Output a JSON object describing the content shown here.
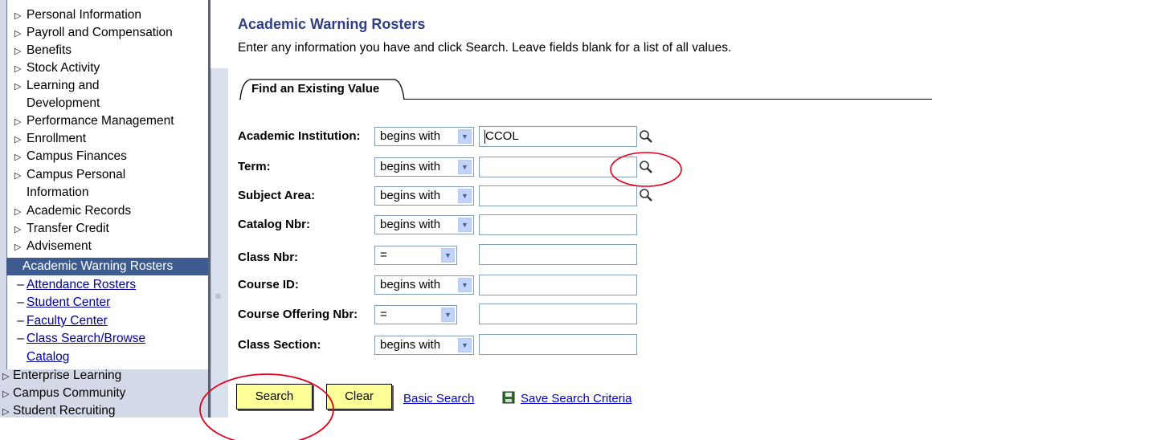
{
  "nav": {
    "items": [
      {
        "label": "Personal Information"
      },
      {
        "label": "Payroll and Compensation"
      },
      {
        "label": "Benefits"
      },
      {
        "label": "Stock Activity"
      },
      {
        "label": "Learning and",
        "cont": "Development"
      },
      {
        "label": "Performance Management"
      },
      {
        "label": "Enrollment"
      },
      {
        "label": "Campus Finances"
      },
      {
        "label": "Campus Personal",
        "cont": "Information"
      },
      {
        "label": "Academic Records"
      },
      {
        "label": "Transfer Credit"
      },
      {
        "label": "Advisement"
      }
    ],
    "selected": "Academic Warning Rosters",
    "links": [
      {
        "label": "Attendance Rosters"
      },
      {
        "label": "Student Center"
      },
      {
        "label": "Faculty Center"
      },
      {
        "label": "Class Search/Browse",
        "cont": "Catalog"
      }
    ],
    "top_items": [
      {
        "label": "Enterprise Learning"
      },
      {
        "label": "Campus Community"
      },
      {
        "label": "Student Recruiting"
      }
    ]
  },
  "page": {
    "title": "Academic Warning Rosters",
    "instructions": "Enter any information you have and click Search. Leave fields blank for a list of all values.",
    "tab_label": "Find an Existing Value"
  },
  "form": {
    "fields": [
      {
        "label": "Academic Institution:",
        "operator": "begins with",
        "value": "CCOL",
        "lookup": true
      },
      {
        "label": "Term:",
        "operator": "begins with",
        "value": "",
        "lookup": true
      },
      {
        "label": "Subject Area:",
        "operator": "begins with",
        "value": "",
        "lookup": true
      },
      {
        "label": "Catalog Nbr:",
        "operator": "begins with",
        "value": "",
        "lookup": false
      },
      {
        "label": "Class Nbr:",
        "operator": "=",
        "value": "",
        "lookup": false
      },
      {
        "label": "Course ID:",
        "operator": "begins with",
        "value": "",
        "lookup": false
      },
      {
        "label": "Course Offering Nbr:",
        "operator": "=",
        "value": "",
        "lookup": false
      },
      {
        "label": "Class Section:",
        "operator": "begins with",
        "value": "",
        "lookup": false
      }
    ]
  },
  "actions": {
    "search_label": "Search",
    "clear_label": "Clear",
    "basic_search_label": "Basic Search",
    "save_criteria_label": "Save Search Criteria"
  },
  "colors": {
    "title": "#2f3e86",
    "nav_selected_bg": "#3e5b8f",
    "button_bg": "#ffff99",
    "link": "#0000cc",
    "annotation": "#e0001b"
  },
  "icons": {
    "lookup": "magnifier-icon",
    "save": "floppy-disk-icon",
    "nav_collapsed": "triangle-right-icon",
    "dropdown": "chevron-down-icon"
  }
}
